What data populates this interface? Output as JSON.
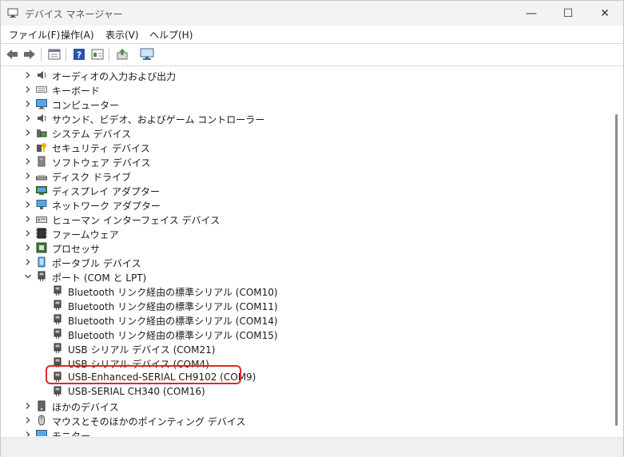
{
  "window": {
    "title": "デバイス マネージャー",
    "minimize": "—",
    "maximize": "☐",
    "close": "✕"
  },
  "menu": [
    "ファイル(F)",
    "操作(A)",
    "表示(V)",
    "ヘルプ(H)"
  ],
  "toolbar_icons": [
    "back-arrow-icon",
    "forward-arrow-icon",
    "properties-icon",
    "help-icon",
    "view-icon",
    "update-driver-icon",
    "monitor-scan-icon"
  ],
  "tree": [
    {
      "label": "オーディオの入力および出力",
      "icon": "speaker-icon",
      "expanded": false
    },
    {
      "label": "キーボード",
      "icon": "keyboard-icon",
      "expanded": false
    },
    {
      "label": "コンピューター",
      "icon": "computer-icon",
      "expanded": false
    },
    {
      "label": "サウンド、ビデオ、およびゲーム コントローラー",
      "icon": "speaker-icon",
      "expanded": false
    },
    {
      "label": "システム デバイス",
      "icon": "system-device-icon",
      "expanded": false
    },
    {
      "label": "セキュリティ デバイス",
      "icon": "security-key-icon",
      "expanded": false
    },
    {
      "label": "ソフトウェア デバイス",
      "icon": "software-device-icon",
      "expanded": false
    },
    {
      "label": "ディスク ドライブ",
      "icon": "disk-drive-icon",
      "expanded": false
    },
    {
      "label": "ディスプレイ アダプター",
      "icon": "display-adapter-icon",
      "expanded": false
    },
    {
      "label": "ネットワーク アダプター",
      "icon": "network-adapter-icon",
      "expanded": false
    },
    {
      "label": "ヒューマン インターフェイス デバイス",
      "icon": "hid-icon",
      "expanded": false
    },
    {
      "label": "ファームウェア",
      "icon": "firmware-icon",
      "expanded": false
    },
    {
      "label": "プロセッサ",
      "icon": "processor-icon",
      "expanded": false
    },
    {
      "label": "ポータブル デバイス",
      "icon": "portable-device-icon",
      "expanded": false
    },
    {
      "label": "ポート (COM と LPT)",
      "icon": "port-icon",
      "expanded": true
    },
    {
      "label": "Bluetooth リンク経由の標準シリアル (COM10)",
      "icon": "port-icon",
      "child": true
    },
    {
      "label": "Bluetooth リンク経由の標準シリアル (COM11)",
      "icon": "port-icon",
      "child": true
    },
    {
      "label": "Bluetooth リンク経由の標準シリアル (COM14)",
      "icon": "port-icon",
      "child": true
    },
    {
      "label": "Bluetooth リンク経由の標準シリアル (COM15)",
      "icon": "port-icon",
      "child": true
    },
    {
      "label": "USB シリアル デバイス (COM21)",
      "icon": "port-icon",
      "child": true
    },
    {
      "label": "USB シリアル デバイス (COM4)",
      "icon": "port-icon",
      "child": true
    },
    {
      "label": "USB-Enhanced-SERIAL CH9102 (COM9)",
      "icon": "port-icon",
      "child": true
    },
    {
      "label": "USB-SERIAL CH340 (COM16)",
      "icon": "port-icon",
      "child": true
    },
    {
      "label": "ほかのデバイス",
      "icon": "other-device-icon",
      "expanded": false
    },
    {
      "label": "マウスとそのほかのポインティング デバイス",
      "icon": "mouse-icon",
      "expanded": false
    },
    {
      "label": "モニター",
      "icon": "monitor-icon",
      "expanded": false
    }
  ],
  "colors": {
    "highlight": "#e0282d",
    "titlebar": "#f3f3f3"
  }
}
